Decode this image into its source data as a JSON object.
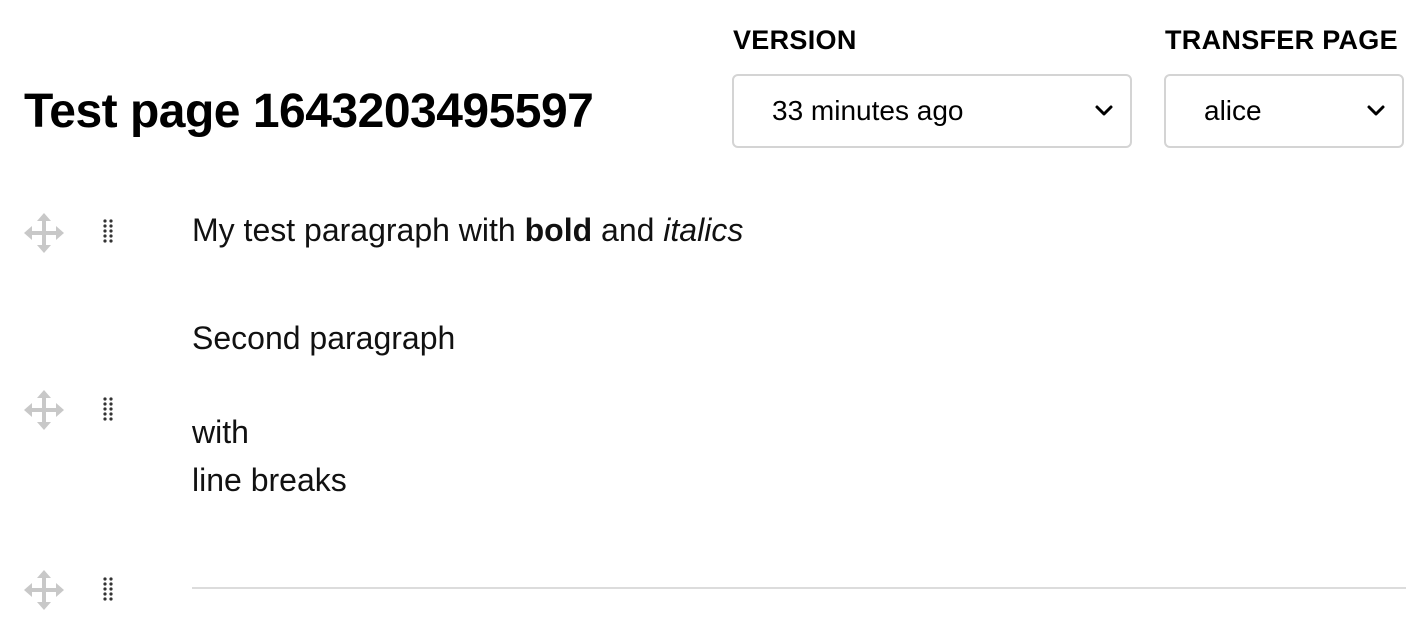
{
  "page": {
    "title": "Test page 1643203495597"
  },
  "version": {
    "label": "VERSION",
    "selected": "33 minutes ago"
  },
  "transfer": {
    "label": "TRANSFER PAGE",
    "selected": "alice"
  },
  "blocks": [
    {
      "paragraph": {
        "prefix": "My test paragraph with ",
        "bold": "bold",
        "middle": " and ",
        "italic": "italics"
      }
    },
    {
      "line1": "Second paragraph",
      "line2": "with",
      "line3": "line breaks"
    },
    {
      "type": "divider"
    }
  ],
  "icons": {
    "move": "move-arrows-icon",
    "drag": "drag-dots-icon",
    "chevron": "chevron-down-icon"
  },
  "colors": {
    "move_icon": "#c8c8c8",
    "drag_icon": "#333333",
    "select_border": "#d4d4d4",
    "divider": "#dcdcdc"
  }
}
